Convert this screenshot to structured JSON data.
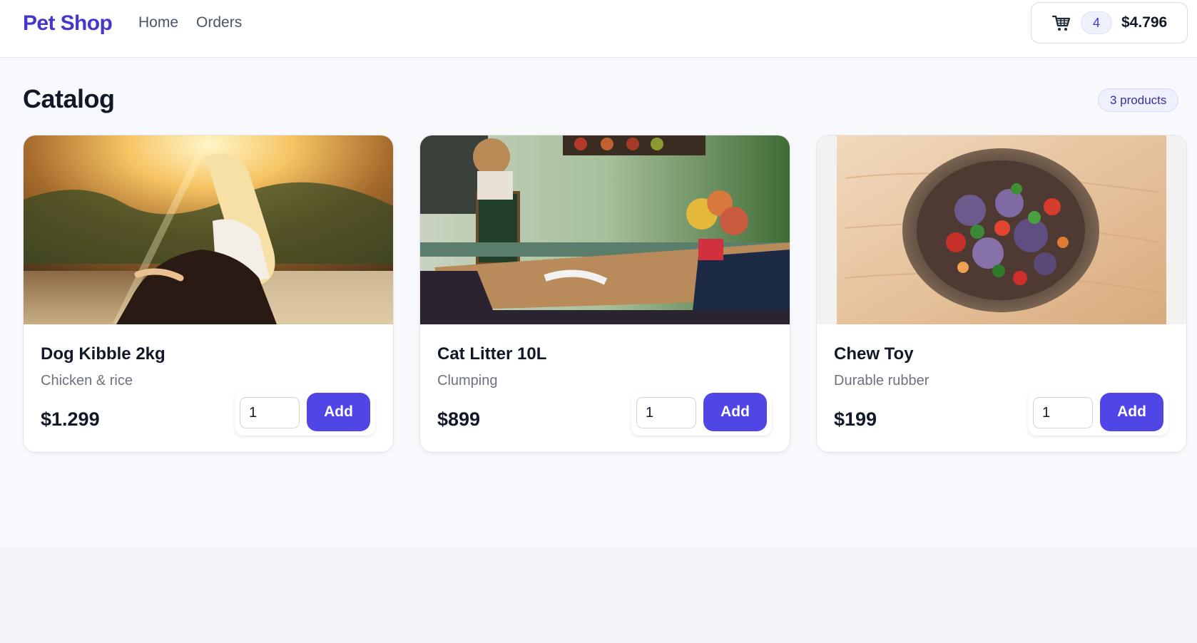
{
  "header": {
    "brand": "Pet Shop",
    "nav": [
      {
        "label": "Home"
      },
      {
        "label": "Orders"
      }
    ],
    "cart": {
      "icon": "cart-icon",
      "count": "4",
      "total": "$4.796"
    }
  },
  "catalog": {
    "title": "Catalog",
    "count_label": "3 products",
    "products": [
      {
        "name": "Dog Kibble 2kg",
        "description": "Chicken & rice",
        "price": "$1.299",
        "quantity": "1",
        "add_label": "Add",
        "image": "woman-by-lake-sunset-photo"
      },
      {
        "name": "Cat Litter 10L",
        "description": "Clumping",
        "price": "$899",
        "quantity": "1",
        "add_label": "Add",
        "image": "cafe-table-with-chalkboard-photo"
      },
      {
        "name": "Chew Toy",
        "description": "Durable rubber",
        "price": "$199",
        "quantity": "1",
        "add_label": "Add",
        "image": "salad-bowl-on-wood-photo"
      }
    ]
  },
  "colors": {
    "brand": "#4338ca",
    "accent": "#4f46e5",
    "text": "#111827",
    "muted": "#6b7280",
    "background": "#f8f9fc"
  }
}
